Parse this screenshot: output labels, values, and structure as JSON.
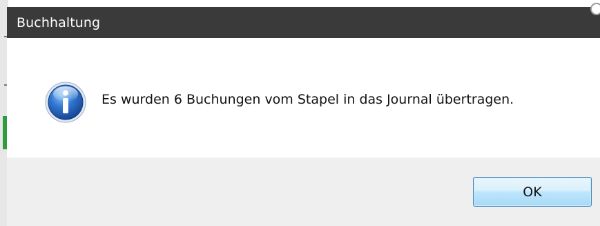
{
  "dialog": {
    "title": "Buchhaltung",
    "message": "Es wurden 6 Buchungen vom Stapel in das Journal übertragen.",
    "icon": "info-icon",
    "ok_label": "OK"
  },
  "colors": {
    "titlebar": "#3a3a3a",
    "footer": "#efefef",
    "button_border": "#3c7fb1",
    "icon_blue": "#1f5fb5"
  }
}
